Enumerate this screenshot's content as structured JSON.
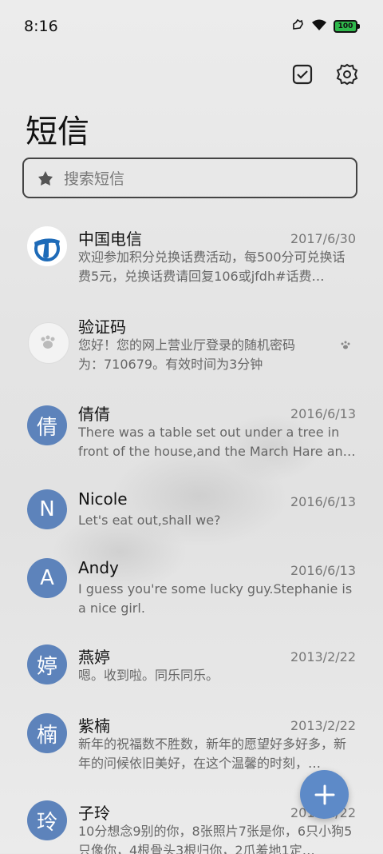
{
  "status_bar": {
    "time": "8:16",
    "battery": "100"
  },
  "header": {
    "title": "短信"
  },
  "search": {
    "placeholder": "搜索短信"
  },
  "messages": [
    {
      "name": "中国电信",
      "date": "2017/6/30",
      "preview": "欢迎参加积分兑换话费活动，每500分可兑换话费5元，兑换话费请回复106或jfdh#话费…",
      "avatar_icon": "china-telecom-logo"
    },
    {
      "name": "验证码",
      "date": "",
      "preview": "您好！您的网上营业厅登录的随机密码为：710679。有效时间为3分钟",
      "avatar_icon": "paw-print-avatar"
    },
    {
      "name": "倩倩",
      "date": "2016/6/13",
      "preview": "There was a table set out under a tree in front of the house,and the March Hare an…",
      "initial": "倩"
    },
    {
      "name": "Nicole",
      "date": "2016/6/13",
      "preview": "Let's eat out,shall we?",
      "initial": "N"
    },
    {
      "name": "Andy",
      "date": "2016/6/13",
      "preview": "I guess you're some lucky guy.Stephanie is a nice girl.",
      "initial": "A"
    },
    {
      "name": "燕婷",
      "date": "2013/2/22",
      "preview": "嗯。收到啦。同乐同乐。",
      "initial": "婷"
    },
    {
      "name": "紫楠",
      "date": "2013/2/22",
      "preview": "新年的祝福数不胜数，新年的愿望好多好多，新年的问候依旧美好，在这个温馨的时刻，…",
      "initial": "楠"
    },
    {
      "name": "子玲",
      "date": "2013/2/22",
      "preview": "10分想念9别的你，8张照片7张是你，6只小狗5只像你，4根骨头3根归你，2爪羞地1定…",
      "initial": "玲"
    }
  ],
  "colors": {
    "avatar": "#5d83bb",
    "fab": "#5d8ac8"
  }
}
